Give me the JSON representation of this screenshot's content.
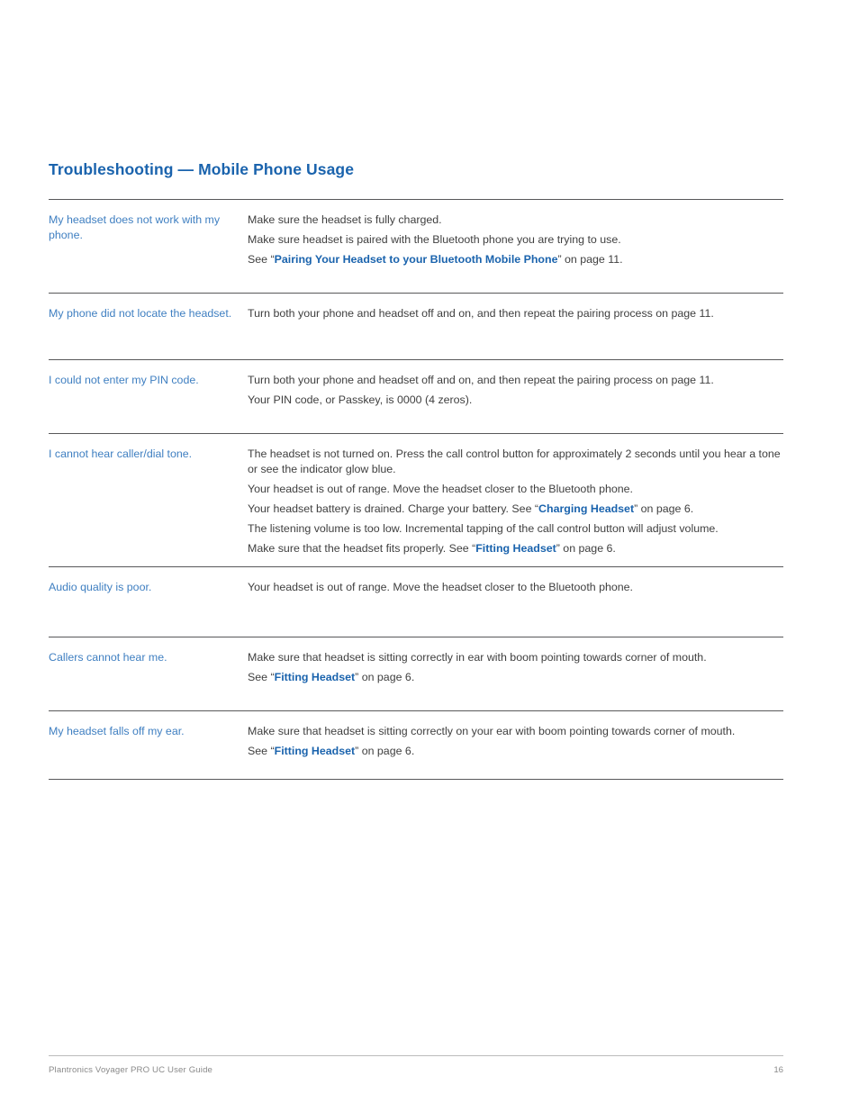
{
  "document": {
    "heading": "Troubleshooting — Mobile Phone Usage",
    "footer_left": "Plantronics Voyager PRO UC User Guide",
    "footer_page": "16"
  },
  "colors": {
    "heading_blue": "#1a63ad",
    "question_blue": "#3f7fc1",
    "link_blue": "#1a63ad",
    "body_text": "#3f3f3f",
    "rule": "#58585a",
    "footer_text": "#8a8a8a"
  },
  "table": {
    "rows": [
      {
        "question": "My headset does not work with my phone.",
        "answers": [
          {
            "pre": "Make sure the headset is fully charged.",
            "link": "",
            "post": ""
          },
          {
            "pre": "Make sure headset is paired with the Bluetooth phone you are trying to use.",
            "link": "",
            "post": ""
          },
          {
            "pre": "See “",
            "link": "Pairing Your Headset to your Bluetooth Mobile Phone",
            "post": "” on page 11."
          }
        ]
      },
      {
        "question": "My phone did not locate the headset.",
        "answers": [
          {
            "pre": "Turn both your phone and headset off and on, and then repeat the pairing process on page 11.",
            "link": "",
            "post": ""
          }
        ]
      },
      {
        "question": "I could not enter my PIN code.",
        "answers": [
          {
            "pre": "Turn both your phone and headset off and on, and then repeat the pairing process on page 11.",
            "link": "",
            "post": ""
          },
          {
            "pre": "Your PIN code, or Passkey, is 0000 (4 zeros).",
            "link": "",
            "post": ""
          }
        ]
      },
      {
        "question": "I cannot hear caller/dial tone.",
        "answers": [
          {
            "pre": "The headset is not turned on. Press the call control button for approximately 2 seconds until you hear a tone or see the indicator glow blue.",
            "link": "",
            "post": ""
          },
          {
            "pre": "Your headset is out of range. Move the headset closer to the Bluetooth phone.",
            "link": "",
            "post": ""
          },
          {
            "pre": "Your headset battery is drained. Charge your battery. See “",
            "link": "Charging Headset",
            "post": "” on page 6."
          },
          {
            "pre": "The listening volume is too low. Incremental tapping of the call control button will adjust volume.",
            "link": "",
            "post": ""
          },
          {
            "pre": "Make sure that the headset fits properly. See “",
            "link": "Fitting Headset",
            "post": "” on page 6."
          }
        ]
      },
      {
        "question": "Audio quality is poor.",
        "answers": [
          {
            "pre": "Your headset is out of range. Move the headset closer to the Bluetooth phone.",
            "link": "",
            "post": ""
          }
        ]
      },
      {
        "question": "Callers cannot hear me.",
        "answers": [
          {
            "pre": "Make sure that headset is sitting correctly in ear with boom pointing towards corner of mouth.",
            "link": "",
            "post": ""
          },
          {
            "pre": "See “",
            "link": "Fitting Headset",
            "post": "” on page 6."
          }
        ]
      },
      {
        "question": "My headset falls off my ear.",
        "answers": [
          {
            "pre": "Make sure that headset is sitting correctly on your ear with boom pointing towards corner of mouth.",
            "link": "",
            "post": ""
          },
          {
            "pre": "See “",
            "link": "Fitting Headset",
            "post": "” on page 6."
          }
        ]
      }
    ]
  }
}
